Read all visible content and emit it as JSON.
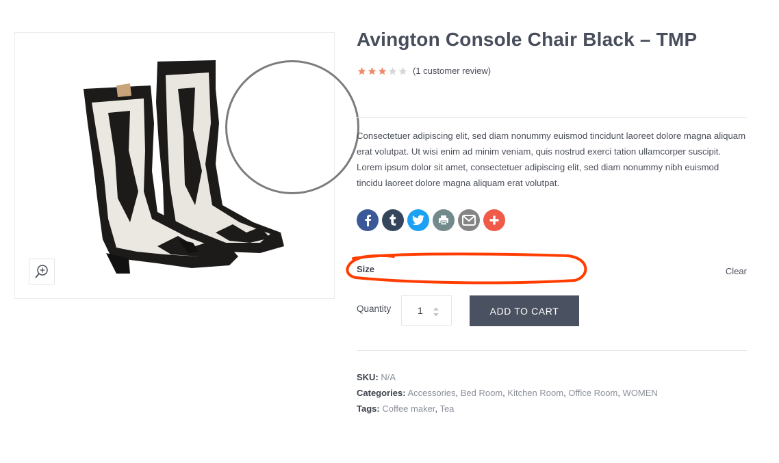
{
  "product": {
    "title": "Avington Console Chair Black – TMP",
    "rating": {
      "value": 3,
      "max": 5,
      "review_text": "(1 customer review)"
    },
    "description": "Consectetuer adipiscing elit, sed diam nonummy euismod tincidunt laoreet dolore magna aliquam erat volutpat. Ut wisi enim ad minim veniam, quis nostrud exerci tation ullamcorper suscipit. Lorem ipsum dolor sit amet, consectetuer adipiscing elit, sed diam nonummy nibh euismod tincidu laoreet dolore magna aliquam erat volutpat."
  },
  "share": [
    {
      "name": "facebook",
      "icon": "facebook-icon",
      "color": "#3b5998"
    },
    {
      "name": "tumblr",
      "icon": "tumblr-icon",
      "color": "#35465c"
    },
    {
      "name": "twitter",
      "icon": "twitter-icon",
      "color": "#1da1f2"
    },
    {
      "name": "print",
      "icon": "print-icon",
      "color": "#738a8d"
    },
    {
      "name": "email",
      "icon": "email-icon",
      "color": "#848484"
    },
    {
      "name": "more",
      "icon": "plus-icon",
      "color": "#f05a48"
    }
  ],
  "variation": {
    "label": "Size",
    "clear_label": "Clear"
  },
  "cart": {
    "quantity_label": "Quantity",
    "quantity_value": "1",
    "button_label": "ADD TO CART"
  },
  "meta": {
    "sku_label": "SKU:",
    "sku_value": "N/A",
    "categories_label": "Categories:",
    "categories": [
      "Accessories",
      "Bed Room",
      "Kitchen Room",
      "Office Room",
      "WOMEN"
    ],
    "tags_label": "Tags:",
    "tags": [
      "Coffee maker",
      "Tea"
    ]
  },
  "colors": {
    "star_filled": "#f08a6c",
    "star_empty": "#d6d6d6",
    "button_bg": "#4a5160",
    "annotation": "#ff3d00"
  },
  "gallery": {
    "zoom_icon": "zoom-in-icon"
  }
}
